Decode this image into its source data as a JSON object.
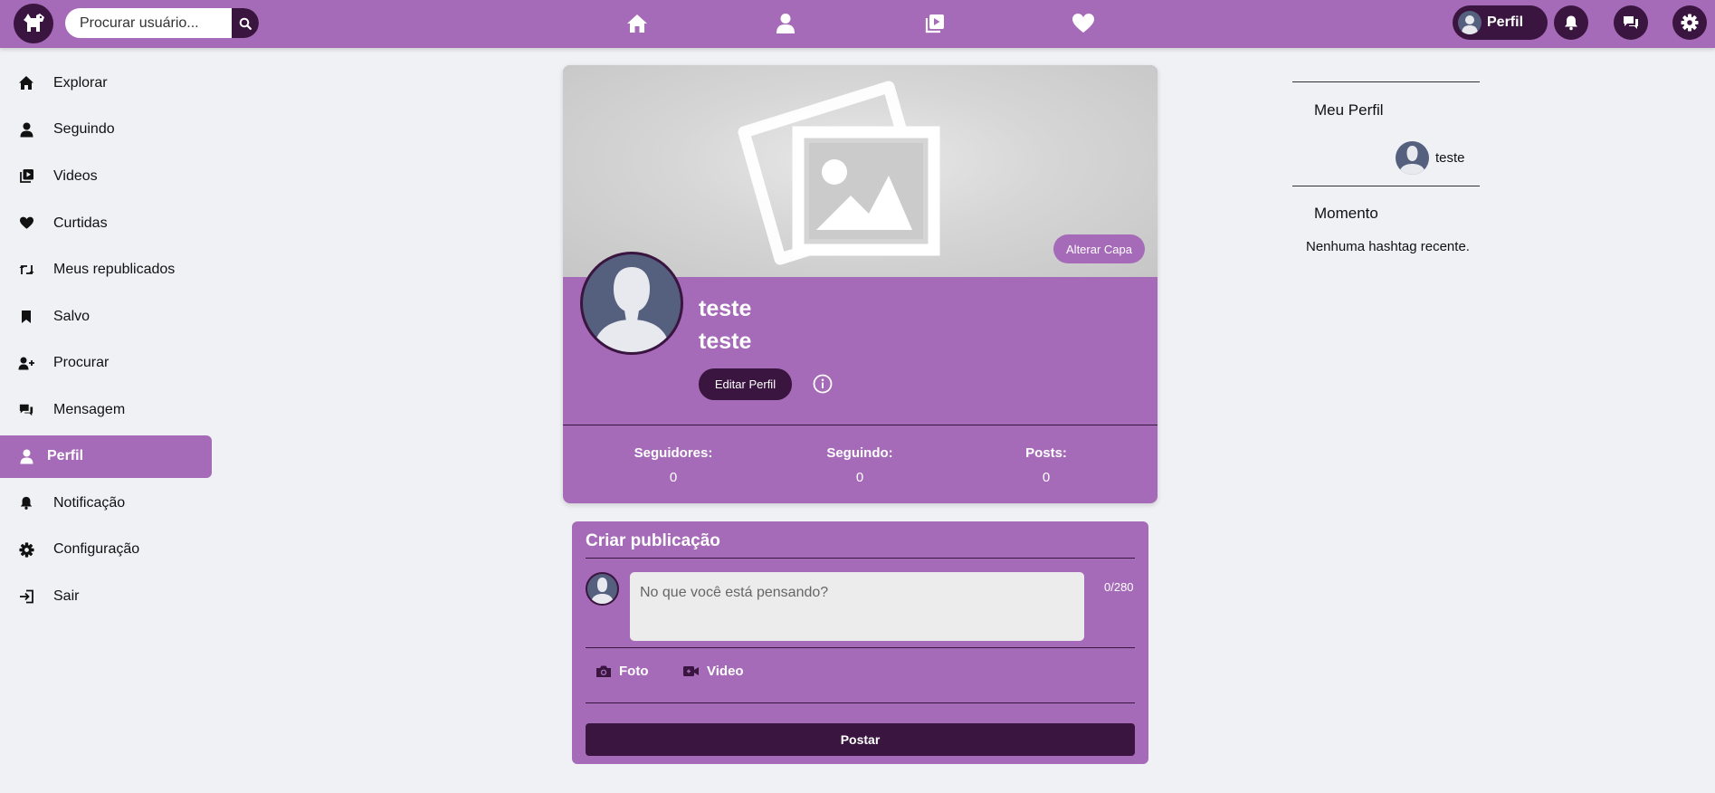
{
  "colors": {
    "primary": "#a66bb8",
    "dark": "#3a1540",
    "background": "#f0f1f5",
    "avatar": "#55607f"
  },
  "header": {
    "logo_icon": "dog-logo-icon",
    "search_placeholder": "Procurar usuário...",
    "nav_icons": [
      "home-icon",
      "user-icon",
      "video-icon",
      "heart-icon"
    ],
    "profile_label": "Perfil"
  },
  "sidebar": {
    "items": [
      {
        "label": "Explorar",
        "icon": "home-icon"
      },
      {
        "label": "Seguindo",
        "icon": "user-icon"
      },
      {
        "label": "Videos",
        "icon": "video-icon"
      },
      {
        "label": "Curtidas",
        "icon": "heart-icon"
      },
      {
        "label": "Meus republicados",
        "icon": "retweet-icon"
      },
      {
        "label": "Salvo",
        "icon": "bookmark-icon"
      },
      {
        "label": "Procurar",
        "icon": "user-plus-icon"
      },
      {
        "label": "Mensagem",
        "icon": "comments-icon"
      },
      {
        "label": "Perfil",
        "icon": "user-icon",
        "active": true
      },
      {
        "label": "Notificação",
        "icon": "bell-icon"
      },
      {
        "label": "Configuração",
        "icon": "gear-icon"
      },
      {
        "label": "Sair",
        "icon": "logout-icon"
      }
    ]
  },
  "profile": {
    "change_cover_label": "Alterar Capa",
    "name": "teste",
    "username": "teste",
    "edit_label": "Editar Perfil",
    "stats": {
      "followers_label": "Seguidores:",
      "followers_value": "0",
      "following_label": "Seguindo:",
      "following_value": "0",
      "posts_label": "Posts:",
      "posts_value": "0"
    }
  },
  "create_post": {
    "title": "Criar publicação",
    "placeholder": "No que você está pensando?",
    "counter": "0/280",
    "photo_label": "Foto",
    "video_label": "Video",
    "submit_label": "Postar"
  },
  "right_panel": {
    "my_profile_title": "Meu Perfil",
    "my_profile_name": "teste",
    "moment_title": "Momento",
    "moment_empty": "Nenhuma hashtag recente."
  }
}
